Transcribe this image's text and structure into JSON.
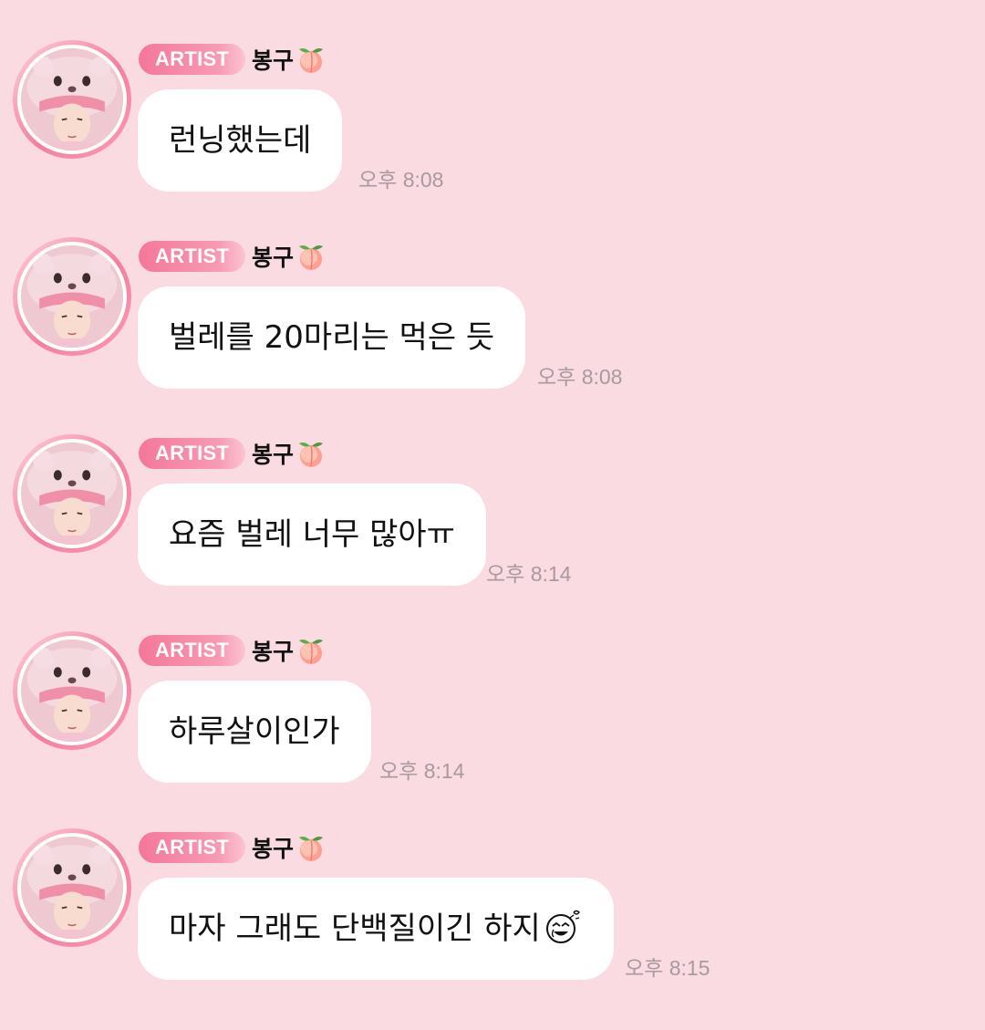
{
  "chat": {
    "messages": [
      {
        "badge": "ARTIST",
        "name": "봉구",
        "name_icon": "peach-icon",
        "text": "런닝했는데",
        "time": "오후 8:08",
        "avatar": "artist-avatar"
      },
      {
        "badge": "ARTIST",
        "name": "봉구",
        "name_icon": "peach-icon",
        "text": "벌레를 20마리는 먹은 듯",
        "time": "오후 8:08",
        "avatar": "artist-avatar"
      },
      {
        "badge": "ARTIST",
        "name": "봉구",
        "name_icon": "peach-icon",
        "text": "요즘 벌레 너무 많아ㅠ",
        "time": "오후 8:14",
        "avatar": "artist-avatar"
      },
      {
        "badge": "ARTIST",
        "name": "봉구",
        "name_icon": "peach-icon",
        "text": "하루살이인가",
        "time": "오후 8:14",
        "avatar": "artist-avatar"
      },
      {
        "badge": "ARTIST",
        "name": "봉구",
        "name_icon": "peach-icon",
        "text": "마자 그래도 단백질이긴 하지",
        "text_icon": "laughing-face-icon",
        "time": "오후 8:15",
        "avatar": "artist-avatar"
      }
    ]
  },
  "colors": {
    "background": "#f9dbe1",
    "badge": "#f4779a",
    "bubble": "#ffffff",
    "timestamp": "#a89aa0"
  }
}
